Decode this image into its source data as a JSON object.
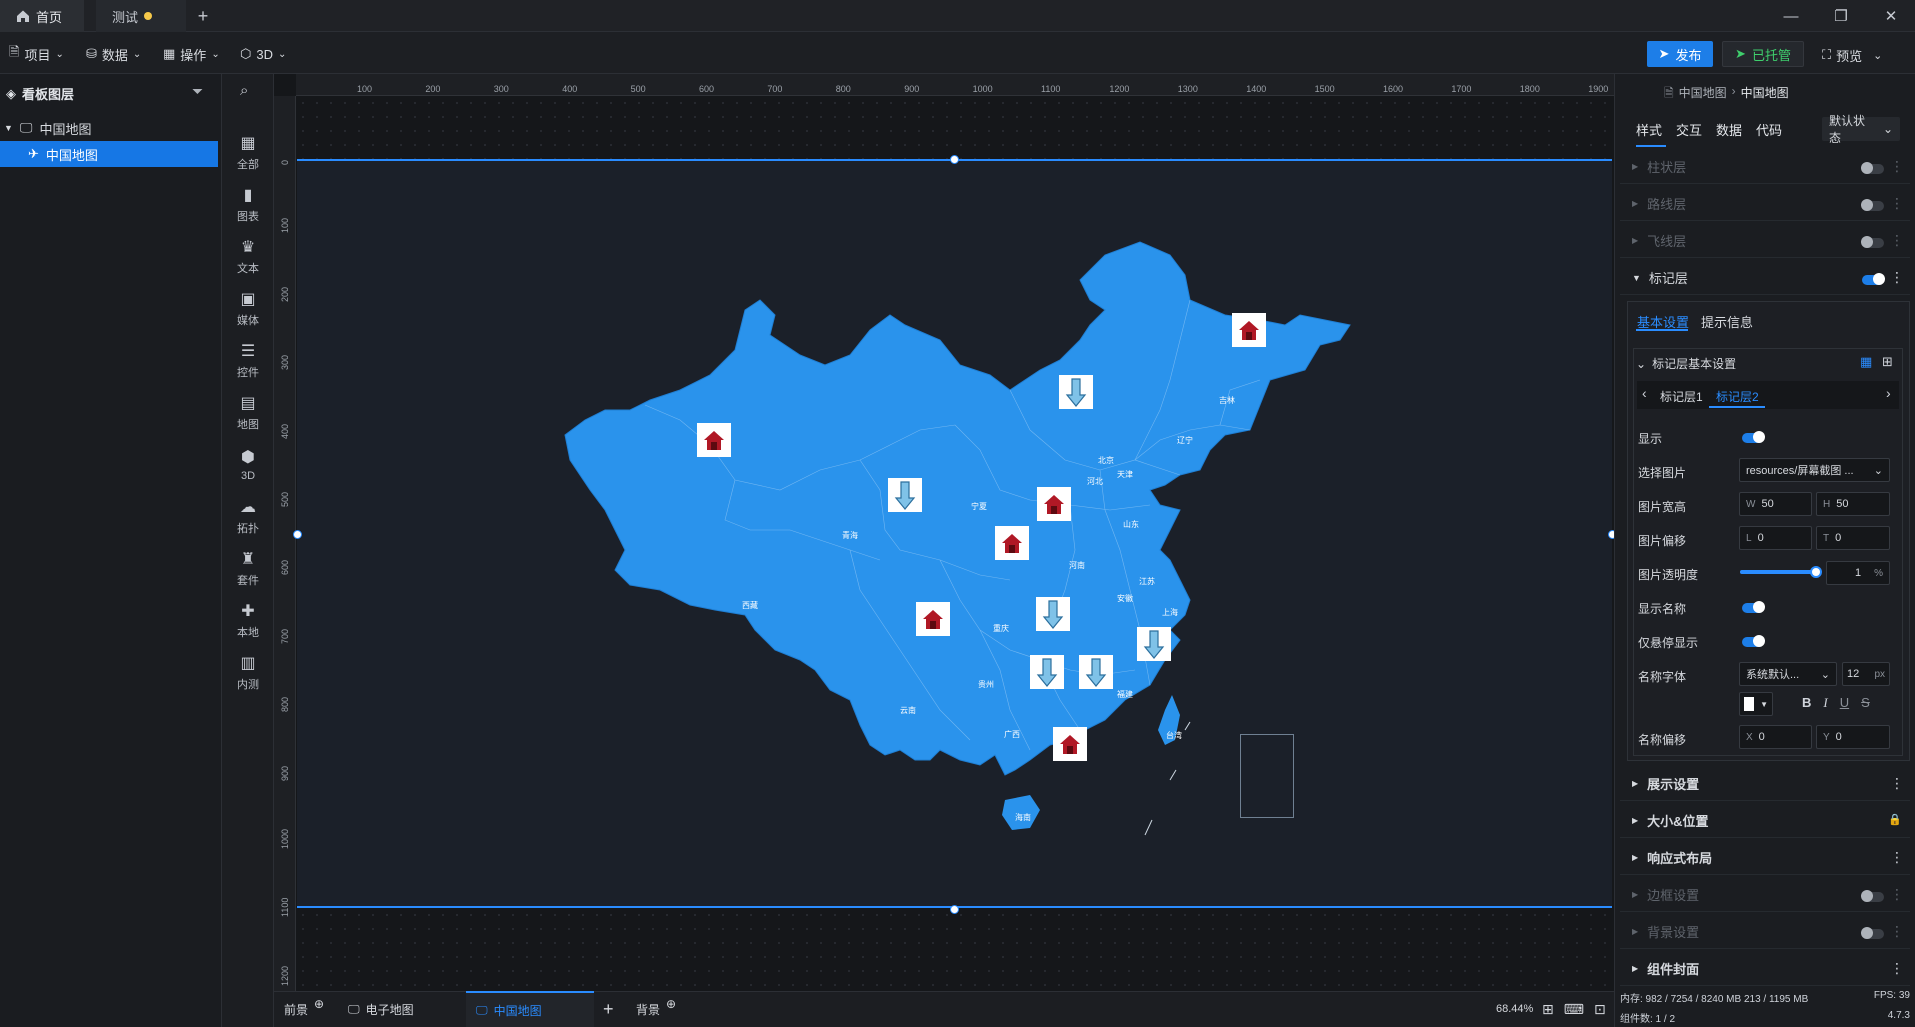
{
  "tabs": {
    "home": "首页",
    "test": "测试"
  },
  "toolbar": {
    "project": "项目",
    "data": "数据",
    "operate": "操作",
    "threed": "3D",
    "publish": "发布",
    "hosted": "已托管",
    "preview": "预览"
  },
  "layers": {
    "title": "看板图层",
    "group": "中国地图",
    "item": "中国地图"
  },
  "iconbar": [
    {
      "label": "全部",
      "icon": "grid-icon"
    },
    {
      "label": "图表",
      "icon": "chart-icon"
    },
    {
      "label": "文本",
      "icon": "text-icon"
    },
    {
      "label": "媒体",
      "icon": "media-icon"
    },
    {
      "label": "控件",
      "icon": "control-icon"
    },
    {
      "label": "地图",
      "icon": "map-icon"
    },
    {
      "label": "3D",
      "icon": "cube-icon"
    },
    {
      "label": "拓扑",
      "icon": "topology-icon"
    },
    {
      "label": "套件",
      "icon": "kit-icon"
    },
    {
      "label": "本地",
      "icon": "puzzle-icon"
    },
    {
      "label": "内测",
      "icon": "beta-icon"
    }
  ],
  "ruler": {
    "top": [
      "100",
      "200",
      "300",
      "400",
      "500",
      "600",
      "700",
      "800",
      "900",
      "1000",
      "1100",
      "1200",
      "1300",
      "1400",
      "1500",
      "1600",
      "1700",
      "1800",
      "1900"
    ],
    "left": [
      "0",
      "100",
      "200",
      "300",
      "400",
      "500",
      "600",
      "700",
      "800",
      "900",
      "1000",
      "1100",
      "1200"
    ]
  },
  "map": {
    "provinces": [
      "北京",
      "天津",
      "河北",
      "辽宁",
      "吉林",
      "山东",
      "青海",
      "宁夏",
      "西藏",
      "河南",
      "安徽",
      "江苏",
      "上海",
      "重庆",
      "贵州",
      "福建",
      "云南",
      "广西",
      "台湾",
      "海南"
    ]
  },
  "bottom": {
    "front": "前景",
    "tab1": "电子地图",
    "tab2": "中国地图",
    "back": "背景",
    "zoom": "68.44%"
  },
  "right": {
    "breadcrumb": {
      "root": "中国地图",
      "leaf": "中国地图"
    },
    "tabs": [
      "样式",
      "交互",
      "数据",
      "代码"
    ],
    "state": "默认状态",
    "sections_top": [
      "柱状层",
      "路线层",
      "飞线层"
    ],
    "marker": "标记层",
    "subtabs": [
      "基本设置",
      "提示信息"
    ],
    "basic_title": "标记层基本设置",
    "layer_tabs": [
      "标记层1",
      "标记层2"
    ],
    "rows": {
      "show": "显示",
      "image": "选择图片",
      "size": "图片宽高",
      "offset": "图片偏移",
      "opacity": "图片透明度",
      "show_name": "显示名称",
      "hover_only": "仅悬停显示",
      "font": "名称字体",
      "name_offset": "名称偏移"
    },
    "values": {
      "image": "resources/屏幕截图 ...",
      "w": "50",
      "h": "50",
      "l": "0",
      "t": "0",
      "opacity": "1",
      "opacity_unit": "%",
      "opacity_level": 0.95,
      "font": "系统默认...",
      "font_size": "12",
      "font_unit": "px",
      "x": "0",
      "y": "0"
    },
    "prefix": {
      "w": "W",
      "h": "H",
      "l": "L",
      "t": "T",
      "x": "X",
      "y": "Y"
    },
    "sections_bottom": [
      "展示设置",
      "大小&位置",
      "响应式布局",
      "边框设置",
      "背景设置",
      "组件封面"
    ],
    "status1": "内存: 982 / 7254 / 8240 MB  213 / 1195 MB",
    "fps": "FPS: 39",
    "status2": "组件数: 1 / 2",
    "version": "4.7.3"
  }
}
